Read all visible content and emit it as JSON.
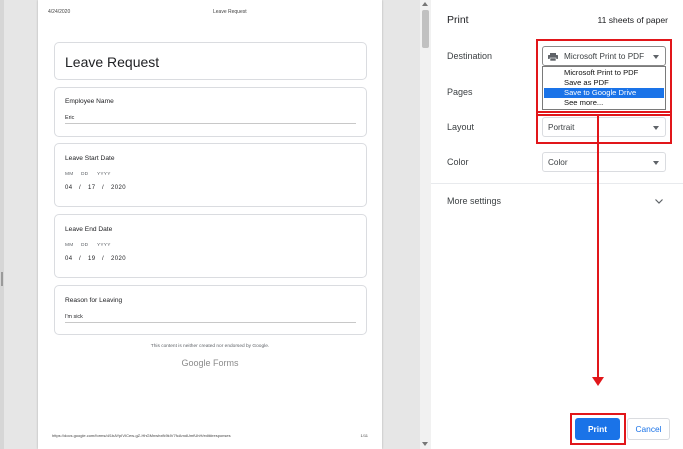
{
  "preview": {
    "header_date": "4/24/2020",
    "header_title": "Leave Request",
    "form_title": "Leave Request",
    "questions": [
      {
        "label": "Employee Name",
        "value": "Eric"
      },
      {
        "label": "Leave Start Date",
        "mm": "MM",
        "dd": "DD",
        "yyyy": "YYYY",
        "month": "04",
        "day": "17",
        "year": "2020",
        "sep": "/"
      },
      {
        "label": "Leave End Date",
        "mm": "MM",
        "dd": "DD",
        "yyyy": "YYYY",
        "month": "04",
        "day": "19",
        "year": "2020",
        "sep": "/"
      },
      {
        "label": "Reason for Leaving",
        "value": "I'm sick"
      }
    ],
    "disclaimer": "This content is neither created nor endorsed by Google.",
    "brand": "Google Forms",
    "footer_url": "https://docs.google.com/forms/d/1bAYpIVICew-gZ-HhGMnwhxfk9kIV7fcAmdUmfUhH/edit#responses",
    "page_number": "1/11"
  },
  "panel": {
    "title": "Print",
    "sheets": "11 sheets of paper",
    "destination_label": "Destination",
    "destination_value": "Microsoft Print to PDF",
    "destination_options": [
      "Microsoft Print to PDF",
      "Save as PDF",
      "Save to Google Drive",
      "See more..."
    ],
    "selected_option_index": 2,
    "pages_label": "Pages",
    "layout_label": "Layout",
    "layout_value": "Portrait",
    "color_label": "Color",
    "color_value": "Color",
    "more_settings": "More settings",
    "print_button": "Print",
    "cancel_button": "Cancel"
  },
  "colors": {
    "accent": "#1a73e8",
    "annotation_red": "#e1161a"
  },
  "icons": [
    "printer-icon",
    "chevron-down-icon",
    "scroll-up-arrow",
    "scroll-down-arrow"
  ]
}
